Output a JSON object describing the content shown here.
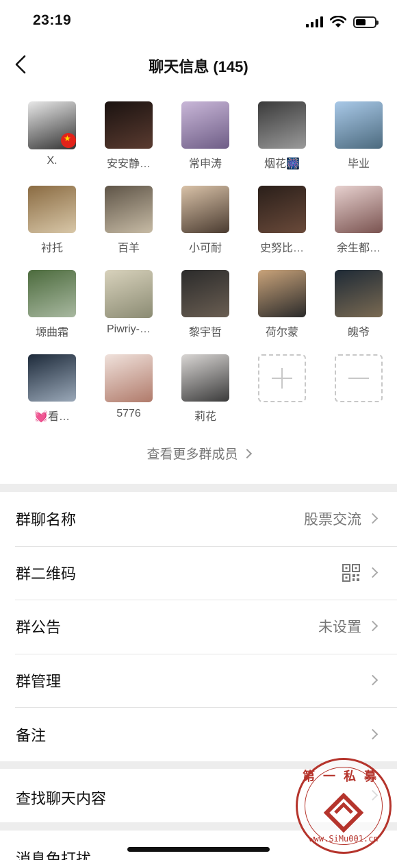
{
  "status_bar": {
    "time": "23:19",
    "battery_level": 0.55
  },
  "nav": {
    "title": "聊天信息 (145)"
  },
  "members": [
    {
      "name": "X.",
      "colors": [
        "#e8e8e8",
        "#333"
      ]
    },
    {
      "name": "安安静…",
      "colors": [
        "#1a1210",
        "#5a3b30"
      ]
    },
    {
      "name": "常申涛",
      "colors": [
        "#c9b7d8",
        "#6e5d86"
      ]
    },
    {
      "name": "烟花🎆",
      "colors": [
        "#3a3a3a",
        "#9a9a9a"
      ]
    },
    {
      "name": "毕业",
      "colors": [
        "#a9c9e8",
        "#4c6a7e"
      ]
    },
    {
      "name": "衬托",
      "colors": [
        "#8a6b42",
        "#d8c7a8"
      ]
    },
    {
      "name": "百羊",
      "colors": [
        "#5e5447",
        "#c7bba5"
      ]
    },
    {
      "name": "小可耐",
      "colors": [
        "#d9c2a8",
        "#4a3b30"
      ]
    },
    {
      "name": "史努比…",
      "colors": [
        "#2a1f1a",
        "#6a4a3a"
      ]
    },
    {
      "name": "余生都…",
      "colors": [
        "#e7d1cf",
        "#7a5350"
      ]
    },
    {
      "name": "塬曲霜",
      "colors": [
        "#4c6b3d",
        "#a8b8a0"
      ]
    },
    {
      "name": "Piwriy-…",
      "colors": [
        "#d8d2bc",
        "#8b8b73"
      ]
    },
    {
      "name": "黎宇哲",
      "colors": [
        "#2b2b2b",
        "#6a5e52"
      ]
    },
    {
      "name": "荷尔蒙",
      "colors": [
        "#c9a37a",
        "#2a2a2a"
      ]
    },
    {
      "name": "魄爷",
      "colors": [
        "#1e2a36",
        "#7a6a52"
      ]
    },
    {
      "name": "💓看…",
      "colors": [
        "#1d2a3a",
        "#9aa8b8"
      ]
    },
    {
      "name": "5776",
      "colors": [
        "#f0e2dc",
        "#b07a6a"
      ]
    },
    {
      "name": "莉花",
      "colors": [
        "#d9d6d4",
        "#3a3a3a"
      ]
    }
  ],
  "view_more": "查看更多群成员",
  "settings": [
    {
      "label": "群聊名称",
      "value": "股票交流"
    },
    {
      "label": "群二维码",
      "value": ""
    },
    {
      "label": "群公告",
      "value": "未设置"
    },
    {
      "label": "群管理",
      "value": ""
    },
    {
      "label": "备注",
      "value": ""
    }
  ],
  "search": {
    "label": "查找聊天内容"
  },
  "dnd": {
    "label": "消息免打扰"
  },
  "watermark": {
    "top": "第一私募",
    "bottom": "www.SiMu001.cn"
  }
}
